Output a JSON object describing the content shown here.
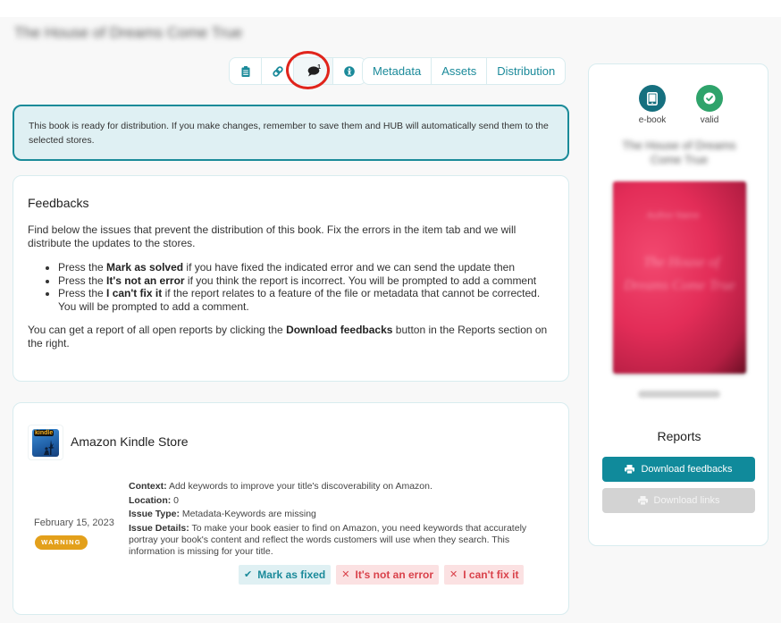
{
  "page": {
    "title": "The House of Dreams Come True"
  },
  "icon_tabs": [
    {
      "name": "clipboard-icon",
      "label": "Details"
    },
    {
      "name": "link-icon",
      "label": "Links"
    },
    {
      "name": "comment-icon",
      "label": "Feedbacks",
      "count": "1",
      "active": true
    },
    {
      "name": "accessibility-icon",
      "label": "Accessibility"
    }
  ],
  "text_tabs": [
    "Metadata",
    "Assets",
    "Distribution"
  ],
  "info_banner": {
    "text": "This book is ready for distribution. If you make changes, remember to save them and HUB will automatically send them to the selected stores."
  },
  "feedbacks": {
    "title": "Feedbacks",
    "intro": "Find below the issues that prevent the distribution of this book. Fix the errors in the item tab and we will distribute the updates to the stores.",
    "bullets": [
      {
        "prefix": "Press the ",
        "bold": "Mark as solved",
        "suffix": " if you have fixed the indicated error and we can send the update then"
      },
      {
        "prefix": "Press the ",
        "bold": "It's not an error",
        "suffix": " if you think the report is incorrect. You will be prompted to add a comment"
      },
      {
        "prefix": "Press the ",
        "bold": "I can't fix it",
        "suffix": " if the report relates to a feature of the file or metadata that cannot be corrected. You will be prompted to add a comment."
      }
    ],
    "outro_prefix": "You can get a report of all open reports by clicking the ",
    "outro_bold": "Download feedbacks",
    "outro_suffix": " button in the Reports section on the right."
  },
  "store_feedback": {
    "store_name": "Amazon Kindle Store",
    "logo_label": "kindle",
    "date": "February 15, 2023",
    "severity": "WARNING",
    "context_label": "Context:",
    "context": "Add keywords to improve your title's discoverability on Amazon.",
    "location_label": "Location:",
    "location": "0",
    "issue_type_label": "Issue Type:",
    "issue_type": "Metadata-Keywords are missing",
    "issue_details_label": "Issue Details:",
    "issue_details": "To make your book easier to find on Amazon, you need keywords that accurately portray your book's content and reflect the words customers will use when they search. This information is missing for your title.",
    "actions": {
      "mark_fixed": "Mark as fixed",
      "not_error": "It's not an error",
      "cant_fix": "I can't fix it"
    }
  },
  "sidebar": {
    "format_label": "e-book",
    "validity_label": "valid",
    "book_title": "The House of Dreams Come True",
    "cover": {
      "author": "Author Name",
      "title_line1": "The House of",
      "title_line2": "Dreams Come True"
    },
    "reports_title": "Reports",
    "download_feedbacks": "Download feedbacks",
    "download_links": "Download links"
  },
  "colors": {
    "accent": "#108a9b",
    "valid": "#2fa36b",
    "warning": "#e3a01b",
    "error": "#d9414a",
    "highlight": "#e0241b"
  }
}
